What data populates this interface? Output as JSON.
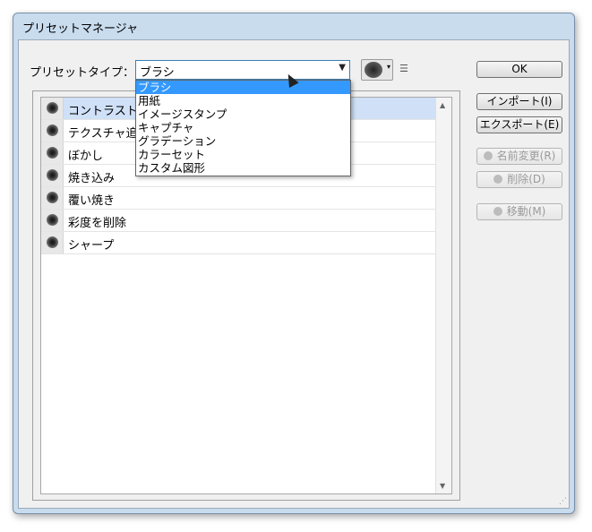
{
  "window": {
    "title": "プリセットマネージャ"
  },
  "preset_type": {
    "label": "プリセットタイプ：",
    "selected": "ブラシ",
    "options": [
      "ブラシ",
      "用紙",
      "イメージスタンプ",
      "キャプチャ",
      "グラデーション",
      "カラーセット",
      "カスタム図形"
    ]
  },
  "list": {
    "items": [
      "コントラスト",
      "テクスチャ追",
      "ぼかし",
      "焼き込み",
      "覆い焼き",
      "彩度を削除",
      "シャープ"
    ],
    "selected_index": 0
  },
  "buttons": {
    "ok": "OK",
    "import": "インポート(I)",
    "export": "エクスポート(E)",
    "rename": "名前変更(R)",
    "delete": "削除(D)",
    "move": "移動(M)"
  },
  "colors": {
    "accent": "#3399ff",
    "selection": "#cfe0f7",
    "title_bg": "#c9dcee"
  },
  "icons": [
    "brush-thumb-icon",
    "scroll-up-icon",
    "scroll-down-icon",
    "brush-picker-icon",
    "cursor-icon"
  ]
}
